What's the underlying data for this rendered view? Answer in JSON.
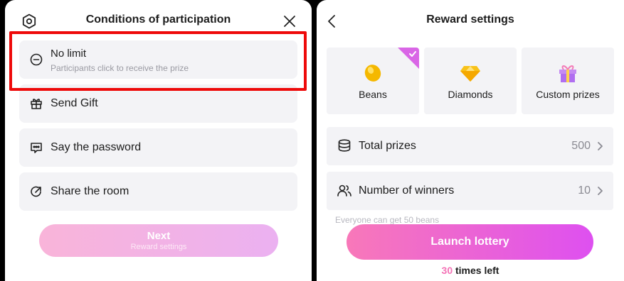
{
  "left": {
    "title": "Conditions of participation",
    "options": [
      {
        "label": "No limit",
        "sublabel": "Participants click to receive the prize",
        "icon": "minus-circle-icon"
      },
      {
        "label": "Send Gift",
        "icon": "gift-icon"
      },
      {
        "label": "Say the password",
        "icon": "chat-bubble-icon"
      },
      {
        "label": "Share the room",
        "icon": "share-arrow-icon"
      }
    ],
    "next_button": {
      "label": "Next",
      "sublabel": "Reward settings"
    }
  },
  "right": {
    "title": "Reward settings",
    "reward_types": [
      {
        "label": "Beans",
        "icon": "bean-icon",
        "selected": true
      },
      {
        "label": "Diamonds",
        "icon": "diamond-icon",
        "selected": false
      },
      {
        "label": "Custom prizes",
        "icon": "gift-box-icon",
        "selected": false
      }
    ],
    "total_prizes": {
      "label": "Total prizes",
      "value": "500"
    },
    "winners": {
      "label": "Number of winners",
      "value": "10"
    },
    "hint": "Everyone can get 50 beans",
    "launch_button": "Launch lottery",
    "times_left": {
      "count": "30",
      "suffix": " times left"
    }
  },
  "colors": {
    "highlight": "#ee0a0a",
    "accent_pink": "#f472b6",
    "accent_purple": "#de50f0",
    "card_bg": "#f3f3f6"
  }
}
